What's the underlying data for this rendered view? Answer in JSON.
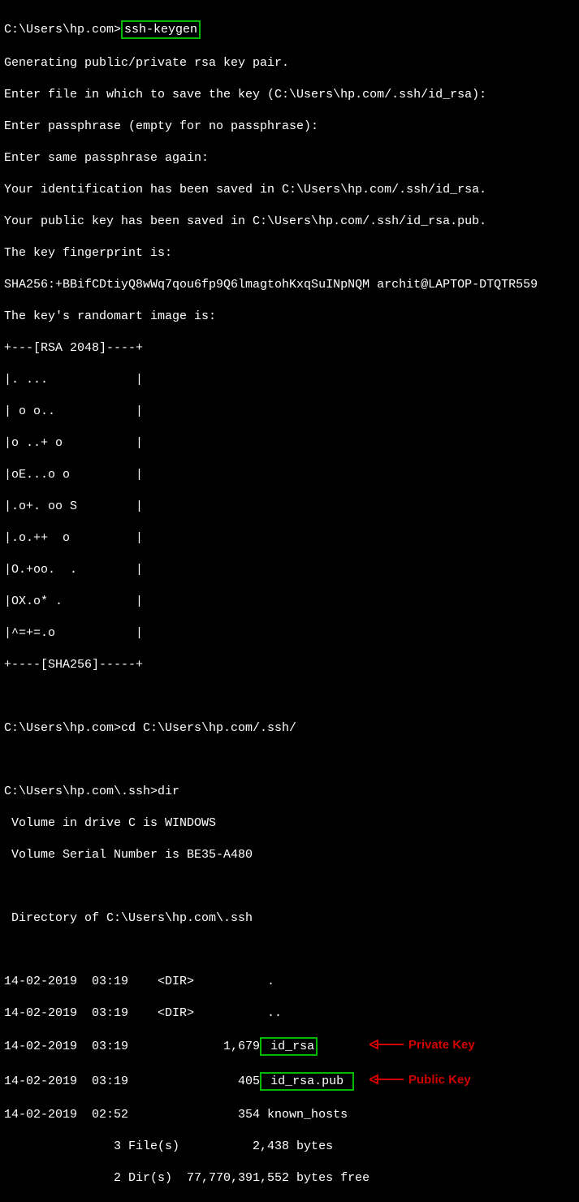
{
  "prompt1": "C:\\Users\\hp.com>",
  "command1": "ssh-keygen",
  "output": {
    "l1": "Generating public/private rsa key pair.",
    "l2": "Enter file in which to save the key (C:\\Users\\hp.com/.ssh/id_rsa):",
    "l3": "Enter passphrase (empty for no passphrase):",
    "l4": "Enter same passphrase again:",
    "l5": "Your identification has been saved in C:\\Users\\hp.com/.ssh/id_rsa.",
    "l6": "Your public key has been saved in C:\\Users\\hp.com/.ssh/id_rsa.pub.",
    "l7": "The key fingerprint is:",
    "l8": "SHA256:+BBifCDtiyQ8wWq7qou6fp9Q6lmagtohKxqSuINpNQM archit@LAPTOP-DTQTR559",
    "l9": "The key's randomart image is:"
  },
  "art": {
    "a0": "+---[RSA 2048]----+",
    "a1": "|. ...            |",
    "a2": "| o o..           |",
    "a3": "|o ..+ o          |",
    "a4": "|oE...o o         |",
    "a5": "|.o+. oo S        |",
    "a6": "|.o.++  o         |",
    "a7": "|O.+oo.  .        |",
    "a8": "|OX.o* .          |",
    "a9": "|^=+=.o           |",
    "a10": "+----[SHA256]-----+"
  },
  "blank1": " ",
  "prompt2": "C:\\Users\\hp.com>cd C:\\Users\\hp.com/.ssh/",
  "blank2": " ",
  "prompt3": "C:\\Users\\hp.com\\.ssh>dir",
  "dir": {
    "d1": " Volume in drive C is WINDOWS",
    "d2": " Volume Serial Number is BE35-A480",
    "d3": " ",
    "d4": " Directory of C:\\Users\\hp.com\\.ssh",
    "d5": " ",
    "d6": "14-02-2019  03:19    <DIR>          .",
    "d7": "14-02-2019  03:19    <DIR>          ..",
    "d8a": "14-02-2019  03:19             1,679",
    "d8b": " id_rsa",
    "d9a": "14-02-2019  03:19               405",
    "d9b": " id_rsa.pub ",
    "d10": "14-02-2019  02:52               354 known_hosts",
    "d11": "               3 File(s)          2,438 bytes",
    "d12": "               2 Dir(s)  77,770,391,552 bytes free"
  },
  "annotations": {
    "private": "Private Key",
    "public": "Public Key"
  }
}
